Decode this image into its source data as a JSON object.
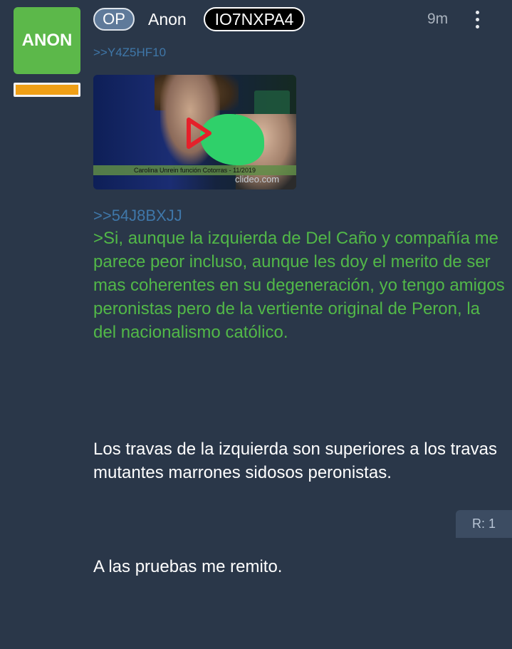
{
  "post": {
    "avatar_text": "ANON",
    "op_badge": "OP",
    "author": "Anon",
    "poster_id": "IO7NXPA4",
    "age": "9m",
    "reply_to": ">>Y4Z5HF10",
    "media": {
      "caption": "Carolina Unrein función Cotorras - 11/2019",
      "watermark": "clideo.com"
    },
    "quote_link": ">>54J8BXJJ",
    "greentext": ">Si, aunque la izquierda de Del Caño y compañía me parece peor incluso, aunque les doy el merito de ser mas coherentes en su degeneración, yo tengo amigos peronistas pero de la vertiente original de Peron, la del nacionalismo católico.",
    "paragraphs": [
      "Los travas de la izquierda son superiores a los travas mutantes marrones sidosos peronistas.",
      "A las pruebas me remito."
    ],
    "replies": "R: 1"
  },
  "colors": {
    "background": "#2a3749",
    "avatar": "#5cb84a",
    "flair": "#ef9f16",
    "greentext": "#52b848",
    "link": "#3f77a9"
  },
  "icons": {
    "menu": "vertical-dots-icon",
    "play": "play-triangle-icon"
  }
}
